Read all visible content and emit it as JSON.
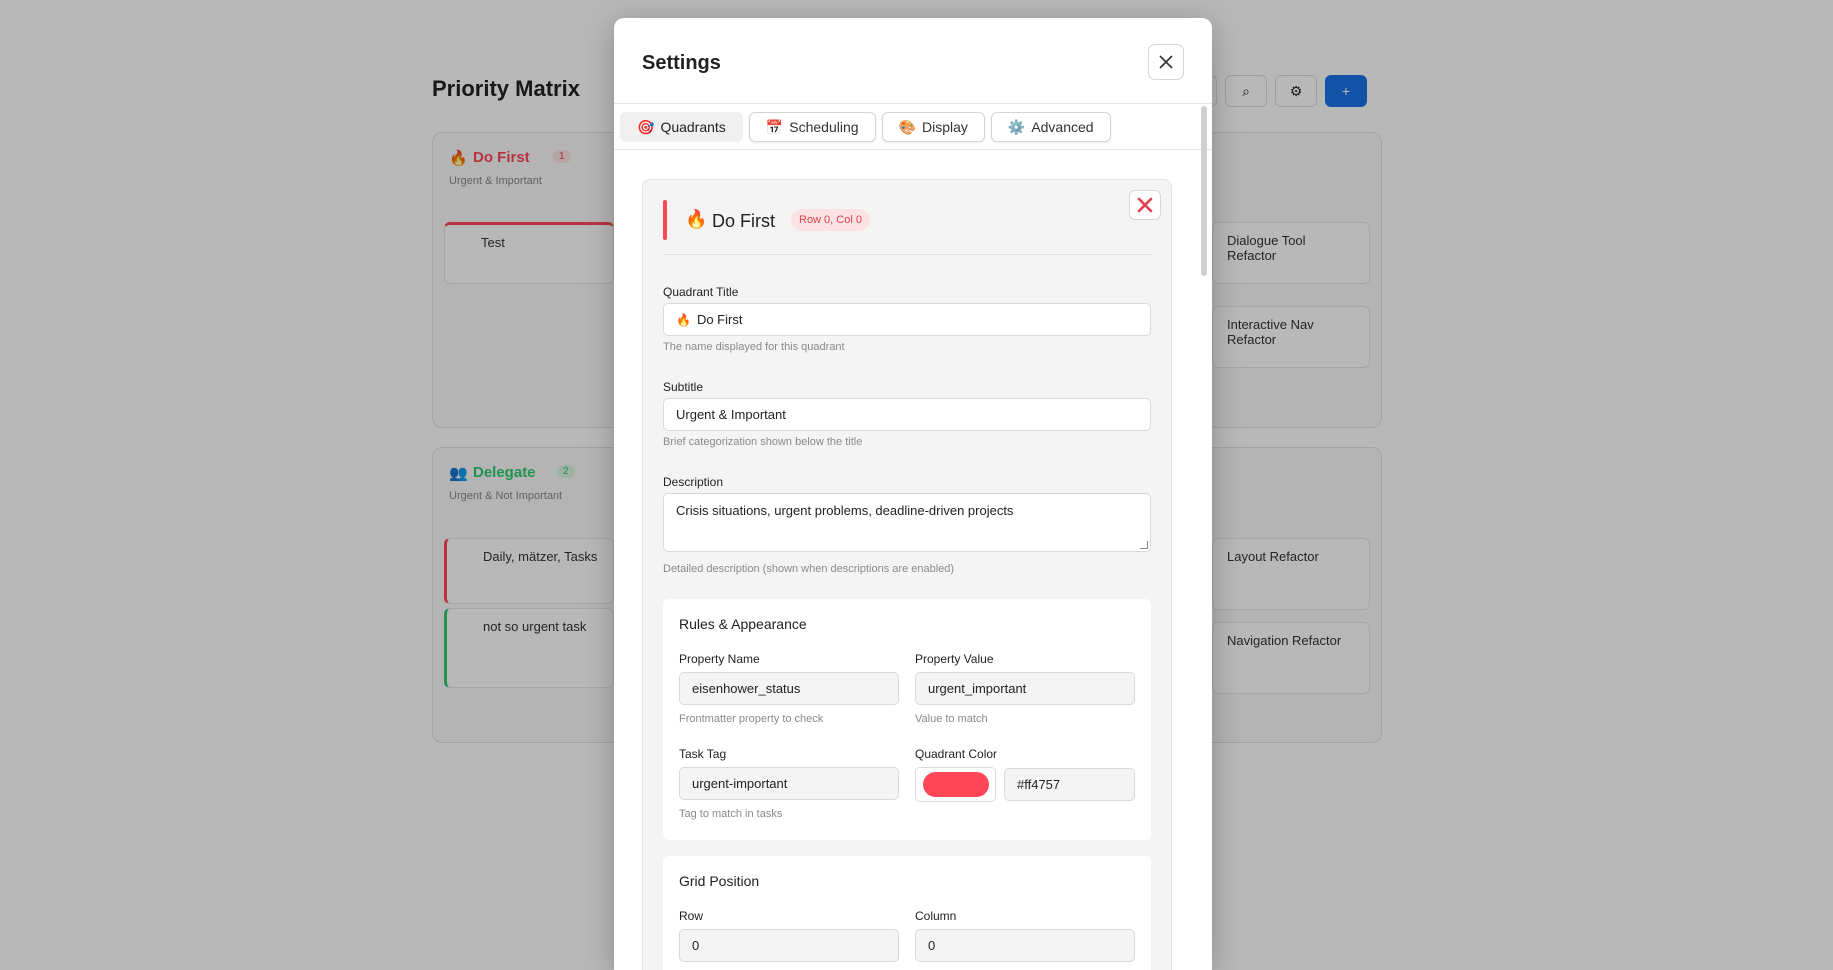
{
  "background": {
    "page_title": "Priority Matrix",
    "quadrants": [
      {
        "emoji": "🔥",
        "title": "Do First",
        "subtitle": "Urgent & Important",
        "count": "1",
        "color": "#ff4757"
      },
      {
        "emoji": "👥",
        "title": "Delegate",
        "subtitle": "Urgent & Not Important",
        "count": "2",
        "color": "#2ecc71"
      }
    ],
    "cards": [
      {
        "text": "Test"
      },
      {
        "text": "Daily, mätzer, Tasks"
      },
      {
        "text": "not so urgent task"
      },
      {
        "text": "Dialogue Tool Refactor"
      },
      {
        "text": "Interactive Nav Refactor"
      },
      {
        "text": "Layout Refactor"
      },
      {
        "text": "Navigation Refactor"
      }
    ]
  },
  "modal": {
    "title": "Settings",
    "tabs": [
      {
        "icon": "🎯",
        "label": "Quadrants",
        "active": true
      },
      {
        "icon": "📅",
        "label": "Scheduling",
        "active": false
      },
      {
        "icon": "🎨",
        "label": "Display",
        "active": false
      },
      {
        "icon": "⚙️",
        "label": "Advanced",
        "active": false
      }
    ],
    "quadrant": {
      "emoji": "🔥",
      "name": "Do First",
      "position_badge": "Row 0, Col 0",
      "accent_color": "#ff4757",
      "title_label": "Quadrant Title",
      "title_value": "Do First",
      "title_hint": "The name displayed for this quadrant",
      "subtitle_label": "Subtitle",
      "subtitle_value": "Urgent & Important",
      "subtitle_hint": "Brief categorization shown below the title",
      "description_label": "Description",
      "description_value": "Crisis situations, urgent problems, deadline-driven projects",
      "description_hint": "Detailed description (shown when descriptions are enabled)"
    },
    "rules": {
      "title": "Rules & Appearance",
      "property_name_label": "Property Name",
      "property_name_value": "eisenhower_status",
      "property_name_hint": "Frontmatter property to check",
      "property_value_label": "Property Value",
      "property_value_value": "urgent_important",
      "property_value_hint": "Value to match",
      "task_tag_label": "Task Tag",
      "task_tag_value": "urgent-important",
      "task_tag_hint": "Tag to match in tasks",
      "color_label": "Quadrant Color",
      "color_value": "#ff4757"
    },
    "grid": {
      "title": "Grid Position",
      "row_label": "Row",
      "row_value": "0",
      "column_label": "Column",
      "column_value": "0"
    }
  }
}
